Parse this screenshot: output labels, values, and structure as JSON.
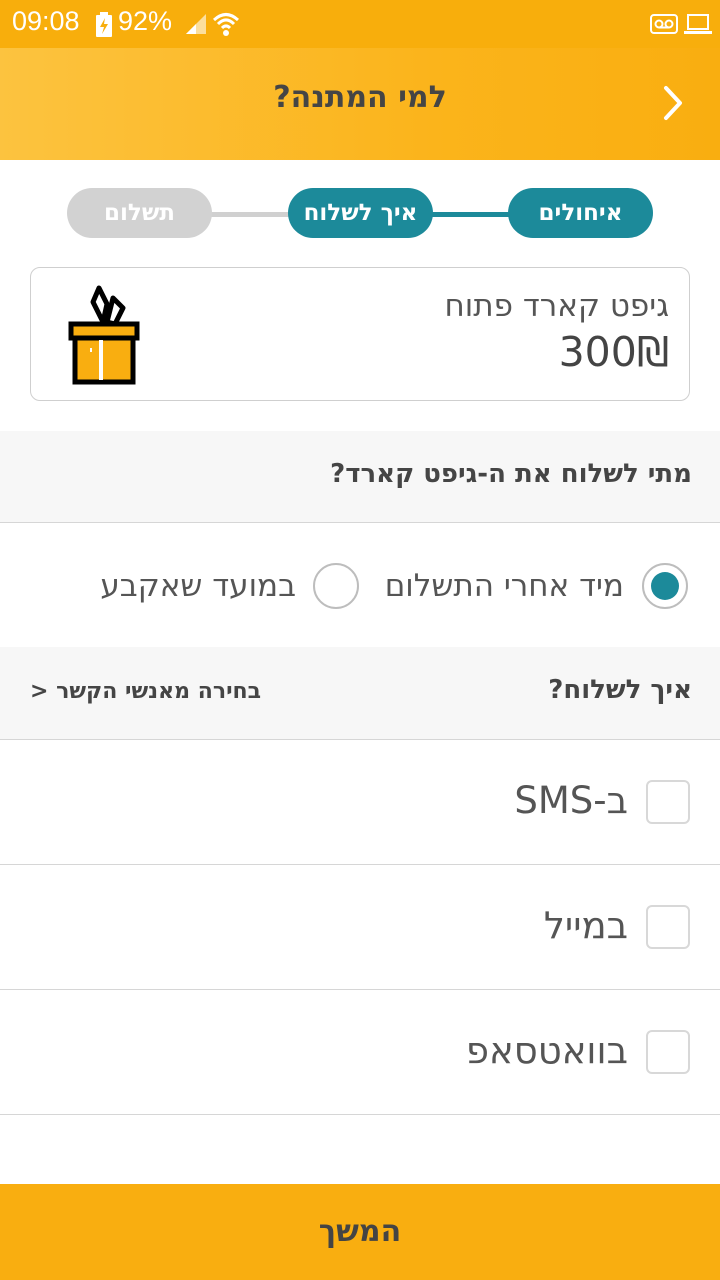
{
  "status_bar": {
    "time": "09:08",
    "battery": "92%",
    "icons": [
      "battery-charging-icon",
      "signal-icon",
      "wifi-icon",
      "voicemail-icon",
      "laptop-icon"
    ]
  },
  "header": {
    "title": "למי המתנה?",
    "back_icon": "chevron-right-icon"
  },
  "stepper": {
    "steps": [
      {
        "label": "איחולים",
        "state": "done"
      },
      {
        "label": "איך לשלוח",
        "state": "active"
      },
      {
        "label": "תשלום",
        "state": "pending"
      }
    ]
  },
  "gift_card": {
    "name": "גיפט קארד פתוח",
    "amount": "300₪",
    "icon": "gift-box-icon"
  },
  "when_section": {
    "title": "מתי לשלוח את ה-גיפט קארד?",
    "options": [
      {
        "label": "מיד אחרי התשלום",
        "selected": true
      },
      {
        "label": "במועד שאקבע",
        "selected": false
      }
    ]
  },
  "how_section": {
    "title": "איך לשלוח?",
    "contacts_link": "בחירה מאנשי הקשר <",
    "options": [
      {
        "label": "ב-SMS",
        "checked": false
      },
      {
        "label": "במייל",
        "checked": false
      },
      {
        "label": "בוואטסאפ",
        "checked": false
      }
    ]
  },
  "continue_button": {
    "label": "המשך"
  },
  "colors": {
    "accent_yellow": "#F9AE10",
    "teal": "#1C8A9A",
    "pending_gray": "#D2D2D2"
  }
}
